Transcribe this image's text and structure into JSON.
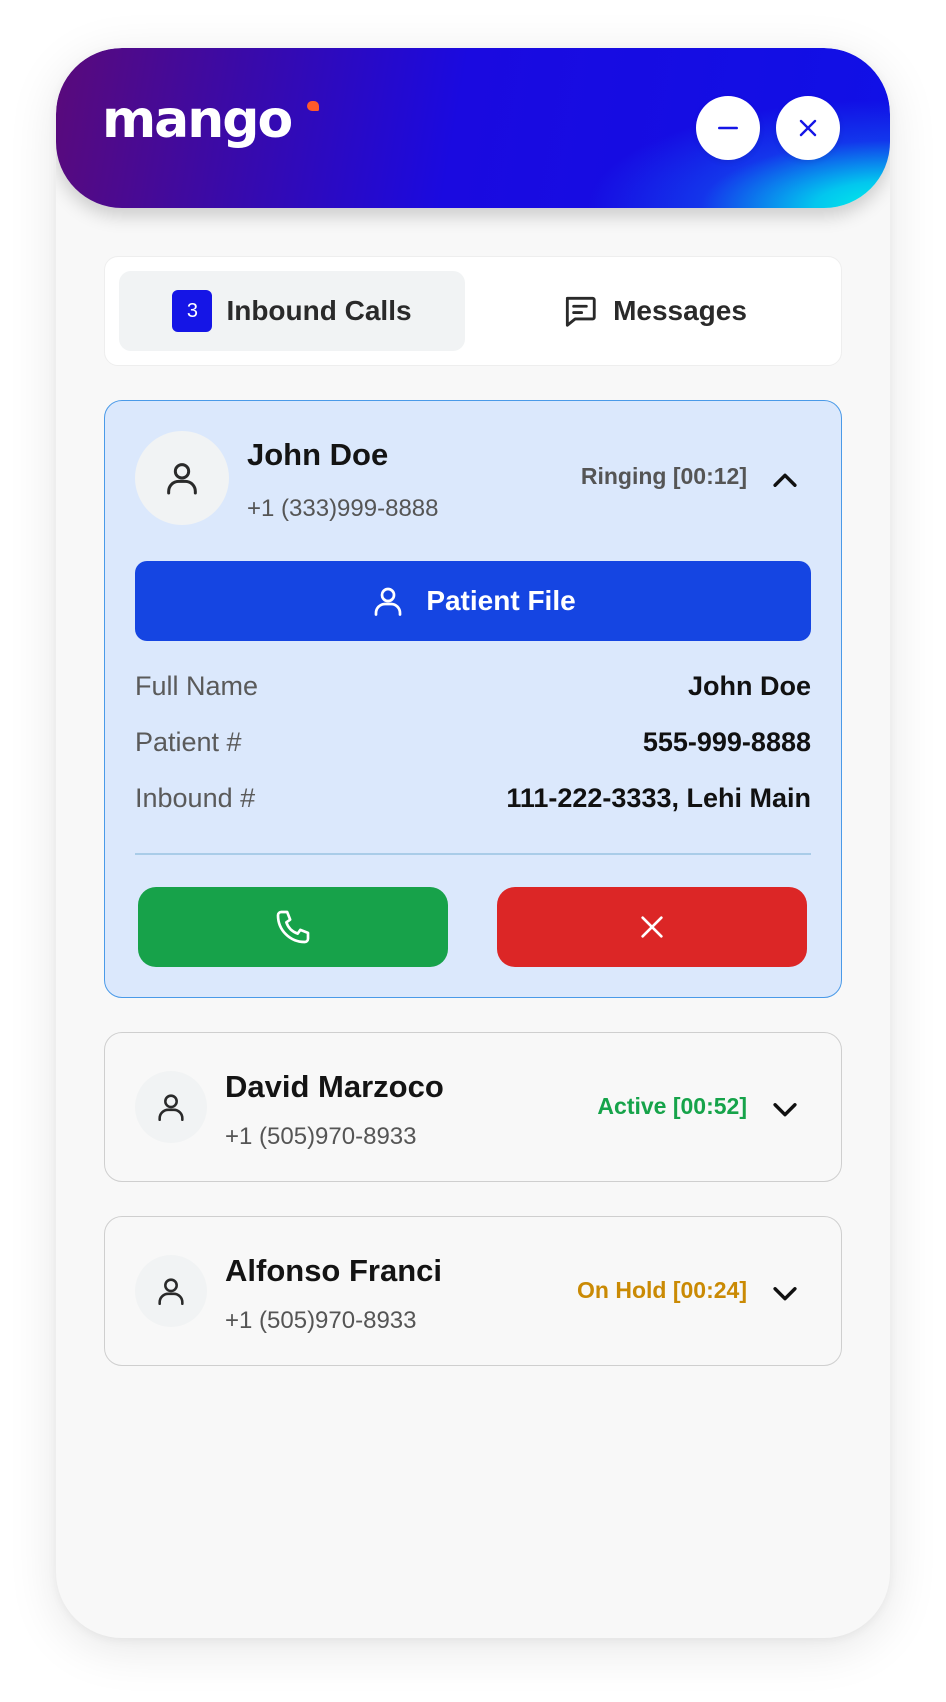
{
  "app": {
    "logo_text": "mango",
    "accent_color": "#1515e6",
    "window_controls": {
      "minimize_icon": "minus-icon",
      "close_icon": "close-icon"
    }
  },
  "tabs": [
    {
      "label": "Inbound Calls",
      "badge": "3",
      "active": true
    },
    {
      "label": "Messages",
      "icon": "message-square-icon",
      "active": false
    }
  ],
  "calls": [
    {
      "name": "John Doe",
      "phone": "+1 (333)999-8888",
      "status": "Ringing [00:12]",
      "status_color": "#555555",
      "expanded": true,
      "patient_file_label": "Patient File",
      "details": [
        {
          "label": "Full Name",
          "value": "John Doe"
        },
        {
          "label": "Patient #",
          "value": "555-999-8888"
        },
        {
          "label": "Inbound #",
          "value": "111-222-3333, Lehi Main"
        }
      ],
      "accept_icon": "phone-icon",
      "decline_icon": "close-icon",
      "accept_color": "#17a24a",
      "decline_color": "#dc2626"
    },
    {
      "name": "David Marzoco",
      "phone": "+1 (505)970-8933",
      "status": "Active [00:52]",
      "status_color": "#16a34a",
      "expanded": false
    },
    {
      "name": "Alfonso Franci",
      "phone": "+1 (505)970-8933",
      "status": "On Hold [00:24]",
      "status_color": "#ca8a04",
      "expanded": false
    }
  ]
}
